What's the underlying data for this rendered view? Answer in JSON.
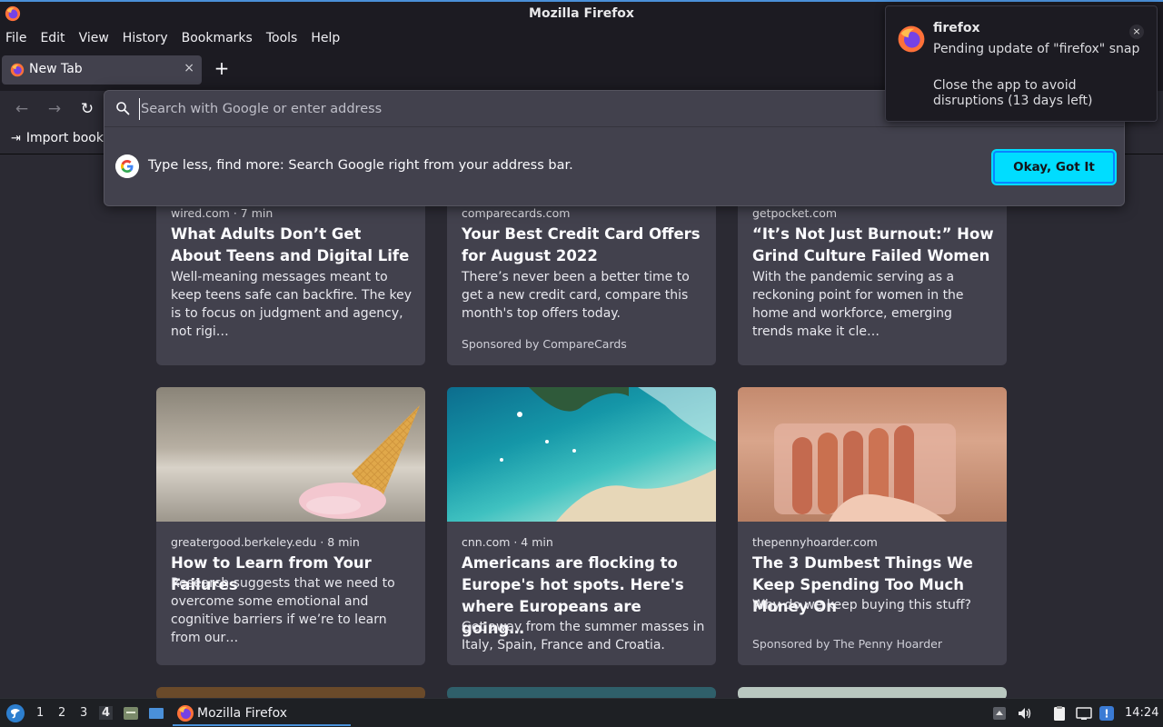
{
  "window": {
    "title": "Mozilla Firefox"
  },
  "menu": [
    "File",
    "Edit",
    "View",
    "History",
    "Bookmarks",
    "Tools",
    "Help"
  ],
  "tab": {
    "label": "New Tab",
    "close_glyph": "×"
  },
  "newtab_glyph": "+",
  "nav": {
    "back_glyph": "←",
    "forward_glyph": "→",
    "reload_glyph": "↻"
  },
  "bookmarks": {
    "import_label": "Import book"
  },
  "urlbar": {
    "placeholder": "Search with Google or enter address",
    "tip_text": "Type less, find more: Search Google right from your address bar.",
    "tip_button": "Okay, Got It"
  },
  "cards": [
    {
      "meta": "wired.com · 7 min",
      "headline": "What Adults Don’t Get About Teens and Digital Life",
      "excerpt": "Well-meaning messages meant to keep teens safe can backfire. The key is to focus on judgment and agency, not rigi…",
      "sponsor": ""
    },
    {
      "meta": "comparecards.com",
      "headline": "Your Best Credit Card Offers for August 2022",
      "excerpt": "There’s never been a better time to get a new credit card, compare this month's top offers today.",
      "sponsor": "Sponsored by CompareCards"
    },
    {
      "meta": "getpocket.com",
      "headline": "“It’s Not Just Burnout:” How Grind Culture Failed Women",
      "excerpt": "With the pandemic serving as a reckoning point for women in the home and workforce, emerging trends make it cle…",
      "sponsor": ""
    },
    {
      "meta": "greatergood.berkeley.edu · 8 min",
      "headline": "How to Learn from Your Failures",
      "excerpt": "Research suggests that we need to overcome some emotional and cognitive barriers if we’re to learn from our…",
      "sponsor": ""
    },
    {
      "meta": "cnn.com · 4 min",
      "headline": "Americans are flocking to Europe's hot spots. Here's where Europeans are going…",
      "excerpt": "Get away from the summer masses in Italy, Spain, France and Croatia.",
      "sponsor": ""
    },
    {
      "meta": "thepennyhoarder.com",
      "headline": "The 3 Dumbest Things We Keep Spending Too Much Money On",
      "excerpt": "Why do we keep buying this stuff?",
      "sponsor": "Sponsored by The Penny Hoarder"
    }
  ],
  "notification": {
    "app": "firefox",
    "line1": "Pending update of \"firefox\" snap",
    "line2": "Close the app to avoid disruptions (13 days left)",
    "close_glyph": "×"
  },
  "taskbar": {
    "workspaces": [
      "1",
      "2",
      "3",
      "4"
    ],
    "active_workspace": "4",
    "task_label": "Mozilla Firefox",
    "clock": "14:24"
  }
}
